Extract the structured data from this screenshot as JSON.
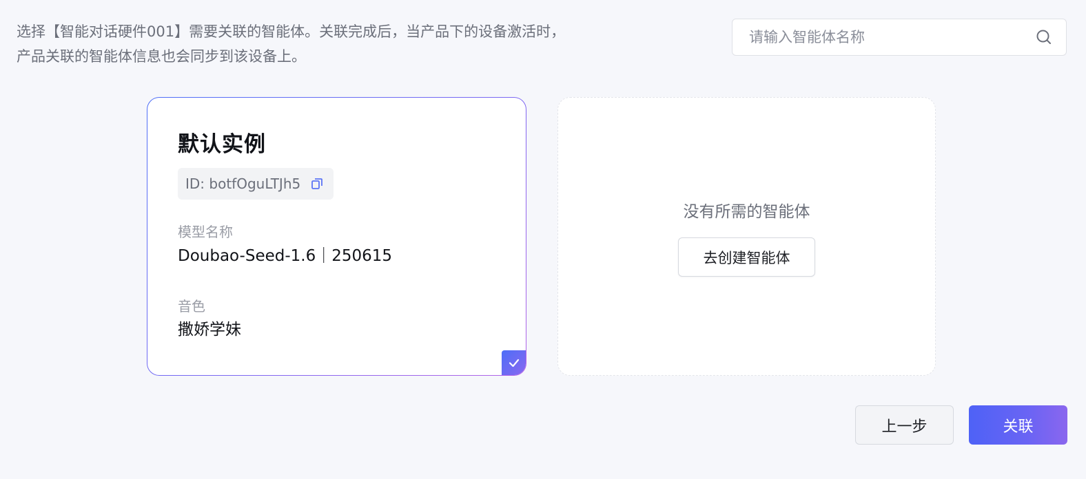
{
  "description": "选择【智能对话硬件001】需要关联的智能体。关联完成后，当产品下的设备激活时，产品关联的智能体信息也会同步到该设备上。",
  "search": {
    "placeholder": "请输入智能体名称",
    "icon": "search-icon"
  },
  "agent_card": {
    "title": "默认实例",
    "id_text": "ID: botfOguLTJh5",
    "copy_icon": "copy-icon",
    "model_label": "模型名称",
    "model_value": "Doubao-Seed-1.6｜250615",
    "voice_label": "音色",
    "voice_value": "撒娇学妹",
    "selected": true,
    "check_icon": "check-icon"
  },
  "empty_card": {
    "text": "没有所需的智能体",
    "create_button": "去创建智能体"
  },
  "footer": {
    "prev_button": "上一步",
    "link_button": "关联"
  },
  "colors": {
    "background": "#f6f7fb",
    "accent": "#4e62f6",
    "accent_end": "#8a66ee",
    "muted_text": "#6b6f7a",
    "label_text": "#9a9da6"
  }
}
